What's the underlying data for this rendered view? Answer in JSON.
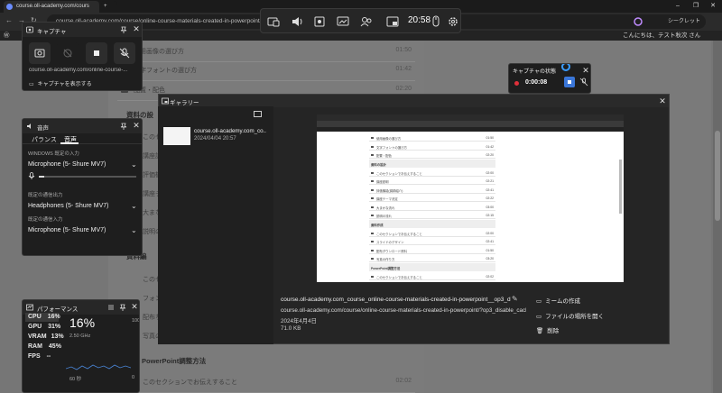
{
  "browser": {
    "tab1": "course.oll-academy.com/cours",
    "tab2_prefix": "co",
    "new_tab": "+",
    "url": "course.oll-academy.com/course/online-course-materials-created-in-powerpoint/?op3_disable_cache=1",
    "profile_label": "シークレット",
    "wp_greeting": "こんにちは、テスト秋次 さん"
  },
  "gamebar": {
    "clock": "20:58"
  },
  "page": {
    "rows": [
      {
        "title": "使用画像の選び方",
        "dur": "01:50"
      },
      {
        "title": "文字フォントの選び方",
        "dur": "01:42"
      },
      {
        "title": "配置・配色",
        "dur": "02:20"
      }
    ],
    "section_head": "資料の設",
    "partials": [
      "このセ",
      "講座説",
      "評価機",
      "講座テ",
      "大まな",
      "説明の"
    ],
    "section_head2": "資料編",
    "partials2": [
      "このセ",
      "フォン",
      "配布ち",
      "写真の"
    ],
    "bottom_head": "PowerPoint調整方法",
    "bottom_row": {
      "title": "このセクションでお伝えすること",
      "dur": "02:02"
    }
  },
  "capture": {
    "title": "キャプチャ",
    "url": "course.oll-academy.com/online-course-...",
    "show_label": "キャプチャを表示する"
  },
  "audio": {
    "title": "音声",
    "tabs": [
      "パランス",
      "音声"
    ],
    "windows_default_label": "WINDOWS 既定の入力",
    "windows_default_device": "Microphone (5- Shure MV7)",
    "default_output_label": "既定の通信出力",
    "default_output_device": "Headphones (5- Shure MV7)",
    "default_input_label": "既定の通信入力",
    "default_input_device": "Microphone (5- Shure MV7)",
    "mic_level": 0.06
  },
  "perf": {
    "title": "パフォーマンス",
    "metrics": [
      {
        "name": "CPU",
        "value": "16%"
      },
      {
        "name": "GPU",
        "value": "31%"
      },
      {
        "name": "VRAM",
        "value": "13%"
      },
      {
        "name": "RAM",
        "value": "45%"
      },
      {
        "name": "FPS",
        "value": "--"
      }
    ],
    "big": "16%",
    "sub": "2.50 GHz",
    "axis_max": "100",
    "axis_min": "0",
    "duration": "60 秒"
  },
  "capstate": {
    "title": "キャプチャの状態",
    "time": "0:00:08"
  },
  "gallery": {
    "title": "ギャラリー",
    "item_name": "course.oll-academy.com_co...",
    "item_date": "2024/04/04 20:57",
    "file_name": "course.oll-academy.com_course_online-course-materials-created-in-powerpoint__op3_disable_c...",
    "file_url": "course.oll-academy.com/course/online-course-materials-created-in-powerpoint/?op3_disable_cache=1...",
    "file_date": "2024年4月4日",
    "file_size": "71.0 KB",
    "actions": [
      "ミームの作成",
      "ファイルの場所を開く",
      "削除"
    ],
    "shot_rows": [
      {
        "t": "使用画像の選び方",
        "d": "01:50"
      },
      {
        "t": "文字フォントの選び方",
        "d": "01:42"
      },
      {
        "t": "配置・配色",
        "d": "02:20"
      },
      {
        "h": "資料の設計"
      },
      {
        "t": "このセクションでお伝えすること",
        "d": "02:00"
      },
      {
        "t": "講座説明",
        "d": "02:21"
      },
      {
        "t": "評価機能(講師紹介)",
        "d": "02:41"
      },
      {
        "t": "講座テーマ決定",
        "d": "02:22"
      },
      {
        "t": "大まかな流れ",
        "d": "03:00"
      },
      {
        "t": "説明の流れ",
        "d": "02:15"
      },
      {
        "h": "資料作成"
      },
      {
        "t": "このセクションでお伝えすること",
        "d": "02:00"
      },
      {
        "t": "スライドのデザイン",
        "d": "02:41"
      },
      {
        "t": "配布ダウンロード資料",
        "d": "01:50"
      },
      {
        "t": "写真の作り方",
        "d": "03:20"
      },
      {
        "h": "PowerPoint調整方法"
      },
      {
        "t": "このセクションでお伝えすること",
        "d": "02:02"
      }
    ]
  }
}
